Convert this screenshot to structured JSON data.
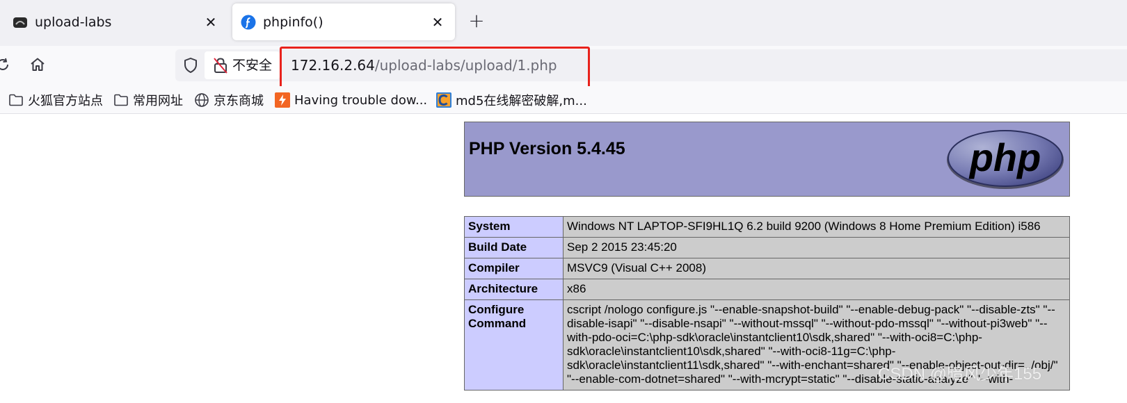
{
  "tabs": [
    {
      "title": "upload-labs",
      "active": false,
      "favicon": "upload-labs-favicon",
      "close": "✕"
    },
    {
      "title": "phpinfo()",
      "active": true,
      "favicon": "php-favicon",
      "close": "✕"
    }
  ],
  "new_tab": "+",
  "nav": {
    "reload_icon": "reload-icon",
    "home_icon": "home-icon",
    "shield_icon": "shield-icon",
    "insecure_label": "不安全",
    "url_host": "172.16.2.64",
    "url_path": "/upload-labs/upload/1.php",
    "highlight_color": "#e8221c"
  },
  "bookmarks": [
    {
      "label": "火狐官方站点",
      "icon": "folder-icon"
    },
    {
      "label": "常用网址",
      "icon": "folder-icon"
    },
    {
      "label": "京东商城",
      "icon": "globe-icon"
    },
    {
      "label": "Having trouble dow...",
      "icon": "bookmark-favicon-orange"
    },
    {
      "label": "md5在线解密破解,m...",
      "icon": "bookmark-favicon-c"
    }
  ],
  "phpinfo": {
    "version_title": "PHP Version 5.4.45",
    "logo_text": "php",
    "header_color": "#9999cc",
    "rows": [
      {
        "key": "System",
        "value": "Windows NT LAPTOP-SFI9HL1Q 6.2 build 9200 (Windows 8 Home Premium Edition) i586"
      },
      {
        "key": "Build Date",
        "value": "Sep 2 2015 23:45:20"
      },
      {
        "key": "Compiler",
        "value": "MSVC9 (Visual C++ 2008)"
      },
      {
        "key": "Architecture",
        "value": "x86"
      },
      {
        "key": "Configure Command",
        "value": "cscript /nologo configure.js \"--enable-snapshot-build\" \"--enable-debug-pack\" \"--disable-zts\" \"--disable-isapi\" \"--disable-nsapi\" \"--without-mssql\" \"--without-pdo-mssql\" \"--without-pi3web\" \"--with-pdo-oci=C:\\php-sdk\\oracle\\instantclient10\\sdk,shared\" \"--with-oci8=C:\\php-sdk\\oracle\\instantclient10\\sdk,shared\" \"--with-oci8-11g=C:\\php-sdk\\oracle\\instantclient11\\sdk,shared\" \"--with-enchant=shared\" \"--enable-object-out-dir=../obj/\" \"--enable-com-dotnet=shared\" \"--with-mcrypt=static\" \"--disable-static-analyze\" \"--with-"
      }
    ]
  },
  "watermark": "CSDN @暗风少年155"
}
